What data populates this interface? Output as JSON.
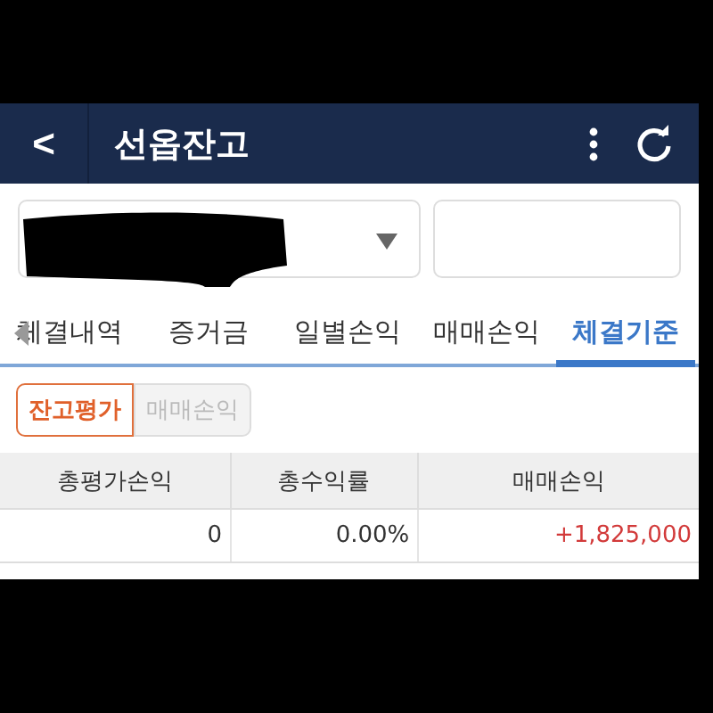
{
  "header": {
    "back": "<",
    "title": "선옵잔고"
  },
  "account": {
    "redacted": true
  },
  "tabs": [
    {
      "label": "체결내역",
      "selected": false
    },
    {
      "label": "증거금",
      "selected": false
    },
    {
      "label": "일별손익",
      "selected": false
    },
    {
      "label": "매매손익",
      "selected": false
    },
    {
      "label": "체결기준",
      "selected": true
    }
  ],
  "segments": [
    {
      "label": "잔고평가",
      "selected": true
    },
    {
      "label": "매매손익",
      "selected": false
    }
  ],
  "table": {
    "columns": [
      "총평가손익",
      "총수익률",
      "매매손익"
    ],
    "rows": [
      [
        {
          "text": "0",
          "color": "#333333"
        },
        {
          "text": "0.00%",
          "color": "#333333"
        },
        {
          "text": "+1,825,000",
          "color": "#d23a3a"
        }
      ]
    ]
  }
}
